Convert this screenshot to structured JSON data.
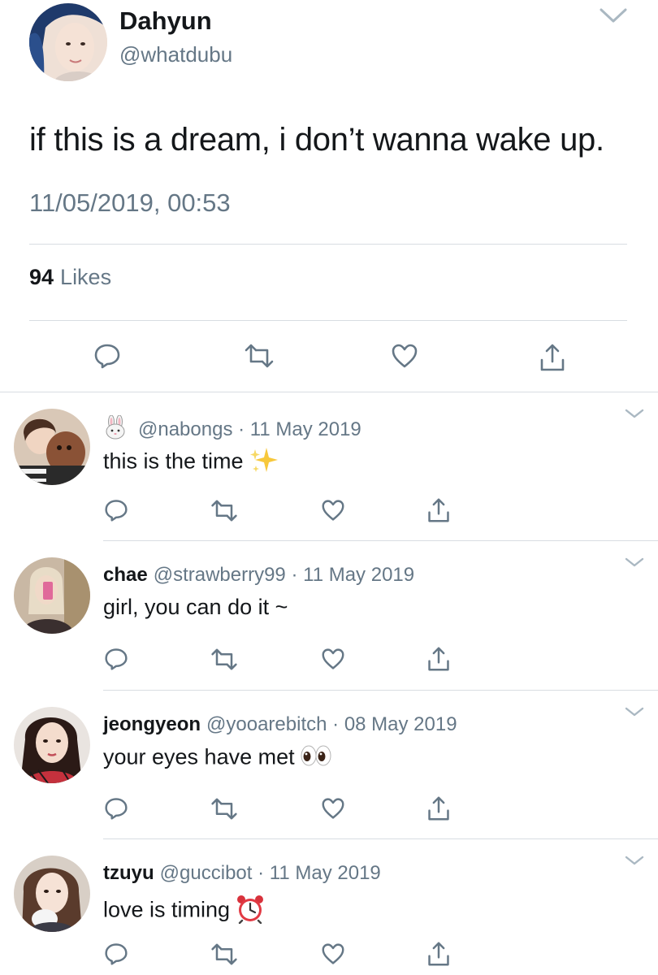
{
  "main_tweet": {
    "author_name": "Dahyun",
    "author_handle": "@whatdubu",
    "avatar": "profile-photo",
    "text": "if this is a dream, i don’t wanna wake up.",
    "timestamp": "11/05/2019, 00:53",
    "likes_count": "94",
    "likes_label": "Likes",
    "actions": [
      "reply-icon",
      "retweet-icon",
      "like-icon",
      "share-icon"
    ]
  },
  "replies": [
    {
      "name": "",
      "name_emoji": "rabbit-face-emoji",
      "handle": "@nabongs",
      "date": "11 May 2019",
      "text": "this is the time",
      "text_emoji": "sparkles-emoji"
    },
    {
      "name": "chae",
      "handle": "@strawberry99",
      "date": "11 May 2019",
      "text": "girl, you can do it ~",
      "text_emoji": ""
    },
    {
      "name": "jeongyeon",
      "handle": "@yooarebitch",
      "date": "08 May 2019",
      "text": "your eyes have met",
      "text_emoji": "eyes-emoji"
    },
    {
      "name": "tzuyu",
      "handle": "@guccibot",
      "date": "11 May 2019",
      "text": "love is timing",
      "text_emoji": "alarm-clock-emoji"
    }
  ],
  "separator": "·",
  "colors": {
    "text": "#14171a",
    "secondary": "#657786",
    "divider": "#d8dde2",
    "icon": "#657786"
  }
}
